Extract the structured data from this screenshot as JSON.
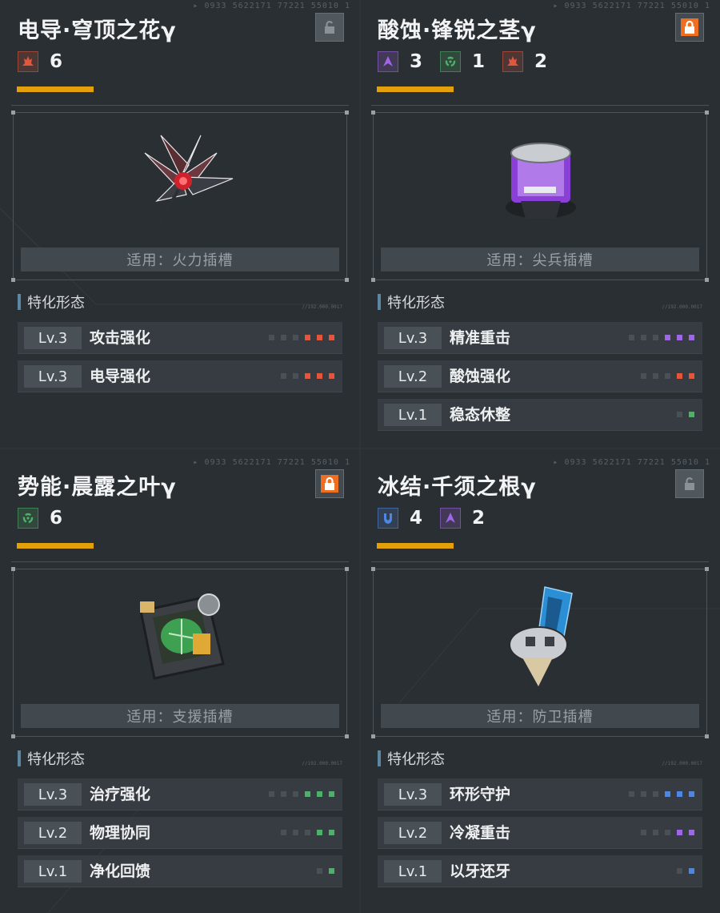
{
  "ui": {
    "section_title": "特化形态",
    "applies_prefix": "适用："
  },
  "colors": {
    "fire": "#e0573c",
    "precision": "#9f66e6",
    "kinetic": "#4fb06a",
    "cryo": "#4f86e0",
    "accent_bar": "#e2a10c",
    "lock_orange": "#ee6f21"
  },
  "cards": [
    {
      "title": "电导·穹顶之花γ",
      "locked": false,
      "tags": [
        {
          "icon": "fire-flame-icon",
          "color": "#e0573c",
          "count": "6"
        }
      ],
      "slot_label": "适用：火力插槽",
      "item_icon": "crimson-crystal-flower-icon",
      "skills": [
        {
          "level": "Lv.3",
          "name": "攻击强化",
          "color": "#e0573c",
          "filled": 3,
          "pips": 6
        },
        {
          "level": "Lv.3",
          "name": "电导强化",
          "color": "#e0573c",
          "filled": 3,
          "pips": 5
        }
      ]
    },
    {
      "title": "酸蚀·锋锐之茎γ",
      "locked": true,
      "tags": [
        {
          "icon": "precision-blade-icon",
          "color": "#9f66e6",
          "count": "3"
        },
        {
          "icon": "kinetic-ring-icon",
          "color": "#4fb06a",
          "count": "1"
        },
        {
          "icon": "fire-flame-icon",
          "color": "#e0573c",
          "count": "2"
        }
      ],
      "slot_label": "适用：尖兵插槽",
      "item_icon": "purple-canister-icon",
      "skills": [
        {
          "level": "Lv.3",
          "name": "精准重击",
          "color": "#9f66e6",
          "filled": 3,
          "pips": 6
        },
        {
          "level": "Lv.2",
          "name": "酸蚀强化",
          "color": "#e0573c",
          "filled": 2,
          "pips": 5
        },
        {
          "level": "Lv.1",
          "name": "稳态休整",
          "color": "#4fb06a",
          "filled": 1,
          "pips": 2
        }
      ]
    },
    {
      "title": "势能·晨露之叶γ",
      "locked": true,
      "tags": [
        {
          "icon": "kinetic-ring-icon",
          "color": "#4fb06a",
          "count": "6"
        }
      ],
      "slot_label": "适用：支援插槽",
      "item_icon": "green-leaf-device-icon",
      "skills": [
        {
          "level": "Lv.3",
          "name": "治疗强化",
          "color": "#4fb06a",
          "filled": 3,
          "pips": 6
        },
        {
          "level": "Lv.2",
          "name": "物理协同",
          "color": "#4fb06a",
          "filled": 2,
          "pips": 5
        },
        {
          "level": "Lv.1",
          "name": "净化回馈",
          "color": "#4fb06a",
          "filled": 1,
          "pips": 2
        }
      ]
    },
    {
      "title": "冰结·千须之根γ",
      "locked": false,
      "tags": [
        {
          "icon": "cryo-shield-icon",
          "color": "#4f86e0",
          "count": "4"
        },
        {
          "icon": "precision-blade-icon",
          "color": "#9f66e6",
          "count": "2"
        }
      ],
      "slot_label": "适用：防卫插槽",
      "item_icon": "blue-crystal-pod-icon",
      "skills": [
        {
          "level": "Lv.3",
          "name": "环形守护",
          "color": "#4f86e0",
          "filled": 3,
          "pips": 6
        },
        {
          "level": "Lv.2",
          "name": "冷凝重击",
          "color": "#9f66e6",
          "filled": 2,
          "pips": 5
        },
        {
          "level": "Lv.1",
          "name": "以牙还牙",
          "color": "#4f86e0",
          "filled": 1,
          "pips": 2
        }
      ]
    }
  ]
}
